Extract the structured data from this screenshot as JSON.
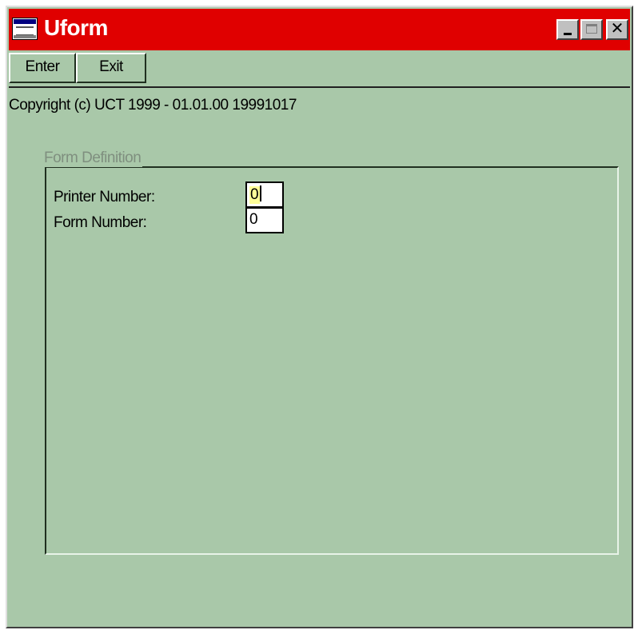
{
  "window": {
    "title": "Uform",
    "icon": "app-window-icon",
    "controls": {
      "minimize": "minimize-icon",
      "maximize": "maximize-icon",
      "close_glyph": "✕"
    }
  },
  "toolbar": {
    "enter_label": "Enter",
    "exit_label": "Exit"
  },
  "copyright": "Copyright (c) UCT 1999 - 01.01.00 19991017",
  "form": {
    "group_title": "Form Definition",
    "printer_label": "Printer Number:",
    "printer_value": "0",
    "form_label": "Form Number:",
    "form_value": "0"
  },
  "colors": {
    "titlebar": "#e00000",
    "background": "#a9c8a9",
    "group_title": "#7f8f7f",
    "selection": "#ffff99"
  }
}
